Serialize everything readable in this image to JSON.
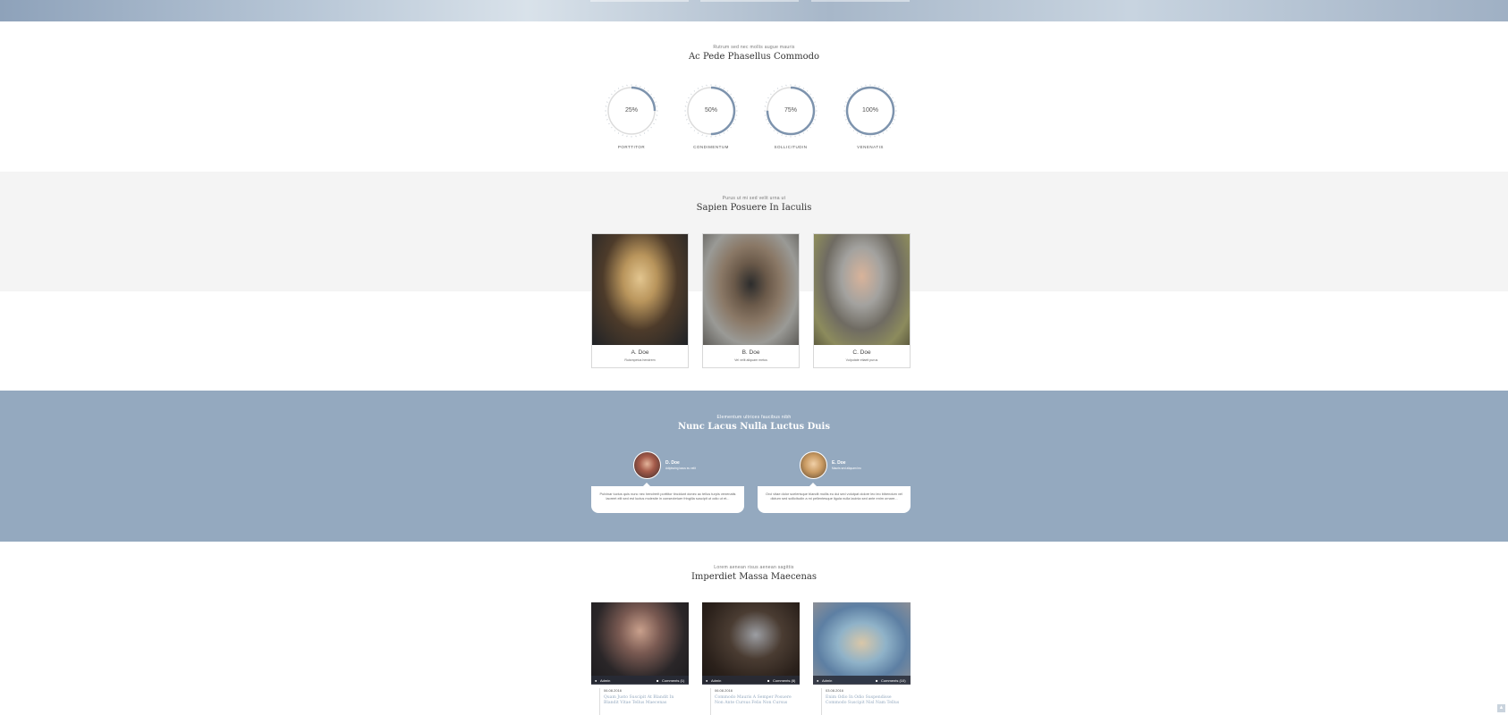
{
  "skills": {
    "kicker": "Rutrum sed nec mollis augue mauris",
    "title": "Ac Pede Phasellus Commodo",
    "accent": "#7d93ad",
    "items": [
      {
        "percent": 25,
        "label_pct": "25%",
        "label": "Porttitor"
      },
      {
        "percent": 50,
        "label_pct": "50%",
        "label": "Condimentum"
      },
      {
        "percent": 75,
        "label_pct": "75%",
        "label": "Sollicitudin"
      },
      {
        "percent": 100,
        "label_pct": "100%",
        "label": "Venenatis"
      }
    ]
  },
  "team": {
    "kicker": "Purus ut mi sed velit urna ut",
    "title": "Sapien Posuere In Iaculis",
    "members": [
      {
        "name": "A. Doe",
        "role": "Ruismpetus hendrem"
      },
      {
        "name": "B. Doe",
        "role": "Vel velit aliquam metus"
      },
      {
        "name": "C. Doe",
        "role": "Vulputate etiaeit purus"
      }
    ]
  },
  "testimonials": {
    "kicker": "Elementum ultrices faucibus nibh",
    "title": "Nunc Lacus Nulla Luctus Duis",
    "items": [
      {
        "name": "D. Doe",
        "role": "Adipiscing lacus eu velit",
        "text": "Pulvinar luctus quis nunc nec hendrerit porttitor tincidunt donec ac tellus turpis venenatis laoreet elit sed est luctus molestie in consectetuer fringilla suscipit ut odio ut et..."
      },
      {
        "name": "E. Doe",
        "role": "Mauris sed aliquam leo",
        "text": "Orci vitae dolor scelerisque blandit mollis eu dui sed volutpat dolore leo leo bibendum vel dictum sed sollicitudin a mi pellentesque ligula nulla lacinia sed ante enim ornare..."
      }
    ]
  },
  "blog": {
    "kicker": "Lorem aenean risus aenean sagittis",
    "title": "Imperdiet Massa Maecenas",
    "posts": [
      {
        "author": "Admin",
        "comments": "Comments (1)",
        "date": "06.08.2016",
        "title": "Quam Justo Suscipit At Blandit In Blandit Vitae Tellus Maecenas"
      },
      {
        "author": "Admin",
        "comments": "Comments (8)",
        "date": "06.08.2016",
        "title": "Commodo Mauris A Semper Posuere Non Ante Cursus Felis Non Cursus"
      },
      {
        "author": "Admin",
        "comments": "Comments (10)",
        "date": "03.08.2016",
        "title": "Enim Odio In Odio Suspendisse Commodo Suscipit Nisl Nam Tellus"
      }
    ]
  }
}
